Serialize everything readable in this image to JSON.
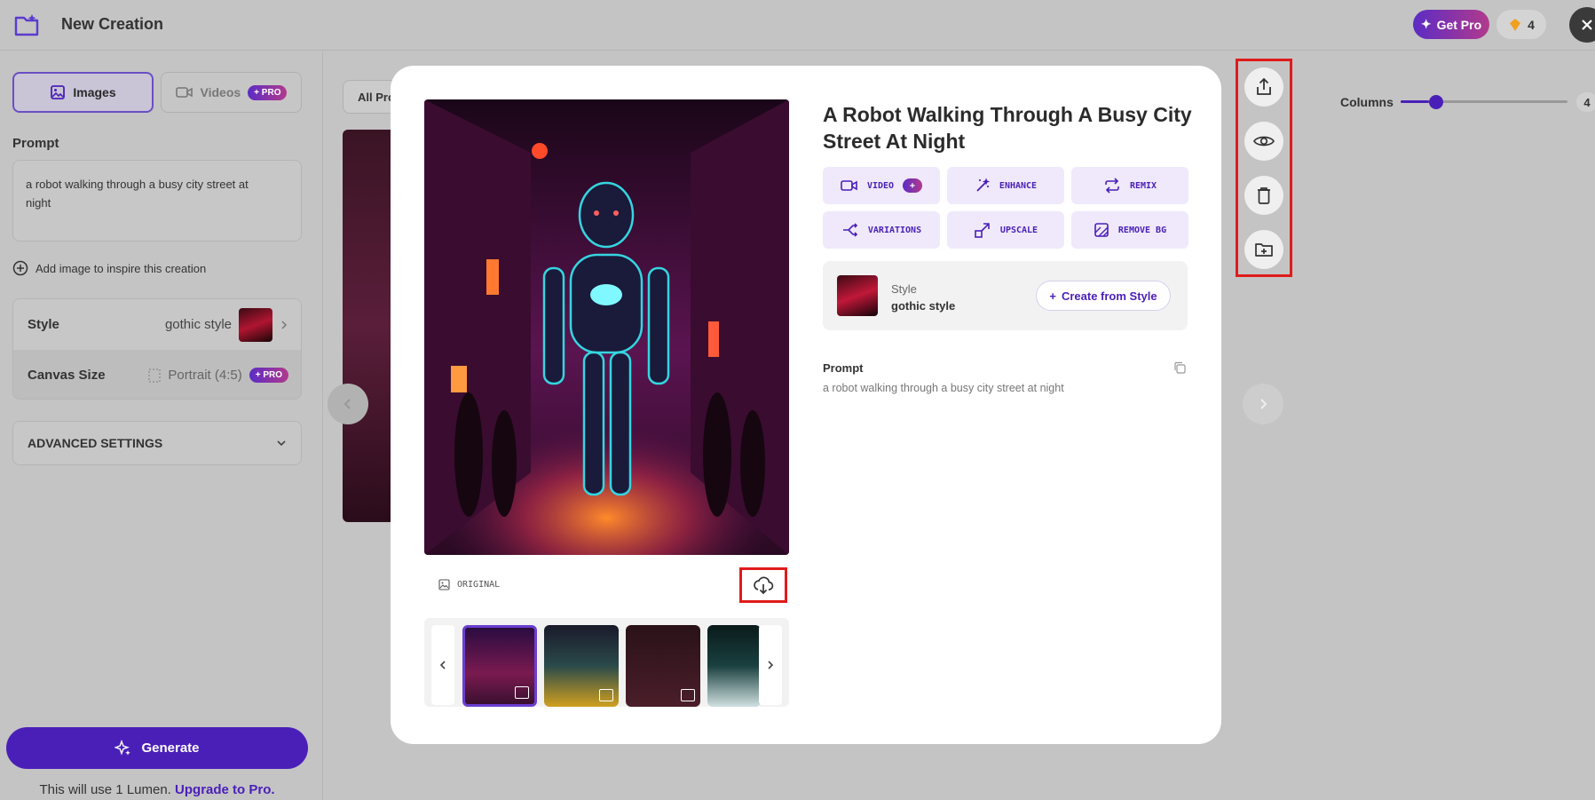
{
  "header": {
    "title": "New Creation",
    "get_pro": "Get Pro",
    "coins": "4"
  },
  "left": {
    "tabs": {
      "images": "Images",
      "videos": "Videos",
      "pro": "PRO"
    },
    "prompt_label": "Prompt",
    "prompt_line1": "a robot walking through a busy city street at",
    "prompt_line2": "night",
    "add_image": "Add image to inspire this creation",
    "style_label": "Style",
    "style_value": "gothic style",
    "canvas_label": "Canvas Size",
    "canvas_value": "Portrait (4:5)",
    "canvas_pro": "PRO",
    "advanced": "ADVANCED SETTINGS",
    "generate": "Generate",
    "lumen_note": "This will use 1 Lumen.",
    "upgrade": "Upgrade to Pro."
  },
  "gallery": {
    "filter": "All Pro",
    "columns_label": "Columns",
    "columns_value": "4",
    "columns_fraction": 0.17
  },
  "modal": {
    "title": "A Robot Walking Through A Busy City Street At Night",
    "actions": {
      "video": "VIDEO",
      "video_badge": "+",
      "enhance": "ENHANCE",
      "remix": "REMIX",
      "variations": "VARIATIONS",
      "upscale": "UPSCALE",
      "remove_bg": "REMOVE BG"
    },
    "style_label": "Style",
    "style_value": "gothic style",
    "create_from_style": "Create from Style",
    "prompt_label": "Prompt",
    "prompt_text": "a robot walking through a busy city street at night",
    "original_label": "ORIGINAL"
  },
  "side_actions": [
    "share-icon",
    "eye-icon",
    "trash-icon",
    "folder-plus-icon"
  ],
  "colors": {
    "accent": "#4a1fb8",
    "highlight": "#e01b1b",
    "pro_gradient_start": "#5b2cc4",
    "pro_gradient_end": "#b23a8c"
  }
}
